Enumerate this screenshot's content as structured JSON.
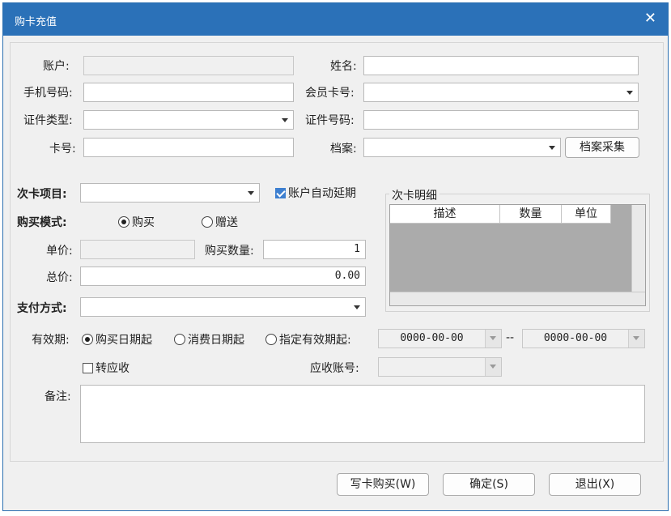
{
  "window": {
    "title": "购卡充值",
    "close_glyph": "✕"
  },
  "form": {
    "account": {
      "label": "账户:",
      "value": ""
    },
    "name": {
      "label": "姓名:",
      "value": ""
    },
    "phone": {
      "label": "手机号码:",
      "value": ""
    },
    "member_card": {
      "label": "会员卡号:",
      "value": ""
    },
    "id_type": {
      "label": "证件类型:",
      "value": ""
    },
    "id_number": {
      "label": "证件号码:",
      "value": ""
    },
    "card_no": {
      "label": "卡号:",
      "value": ""
    },
    "archive": {
      "label": "档案:",
      "value": ""
    },
    "archive_collect_button": "档案采集"
  },
  "purchase": {
    "card_item": {
      "label": "次卡项目:",
      "value": ""
    },
    "auto_extend": {
      "label": "账户自动延期",
      "checked": true
    },
    "mode": {
      "label": "购买模式:",
      "options": [
        "购买",
        "赠送"
      ],
      "selected": "购买"
    },
    "unit_price": {
      "label": "单价:",
      "value": ""
    },
    "quantity": {
      "label": "购买数量:",
      "value": "1"
    },
    "total": {
      "label": "总价:",
      "value": "0.00"
    },
    "payment": {
      "label": "支付方式:",
      "value": ""
    }
  },
  "detail": {
    "title": "次卡明细",
    "columns": [
      "描述",
      "数量",
      "单位"
    ]
  },
  "validity": {
    "label": "有效期:",
    "options": [
      "购买日期起",
      "消费日期起",
      "指定有效期起:"
    ],
    "selected": "购买日期起",
    "start_date": "0000-00-00",
    "separator": "--",
    "end_date": "0000-00-00"
  },
  "receivable": {
    "transfer_label": "转应收",
    "transfer_checked": false,
    "account_label": "应收账号:",
    "account_value": ""
  },
  "remarks": {
    "label": "备注:",
    "value": ""
  },
  "buttons": {
    "write_card": "写卡购买(W)",
    "ok": "确定(S)",
    "exit": "退出(X)"
  },
  "colors": {
    "titlebar": "#2b71b8",
    "check_accent": "#3d7fd0"
  }
}
